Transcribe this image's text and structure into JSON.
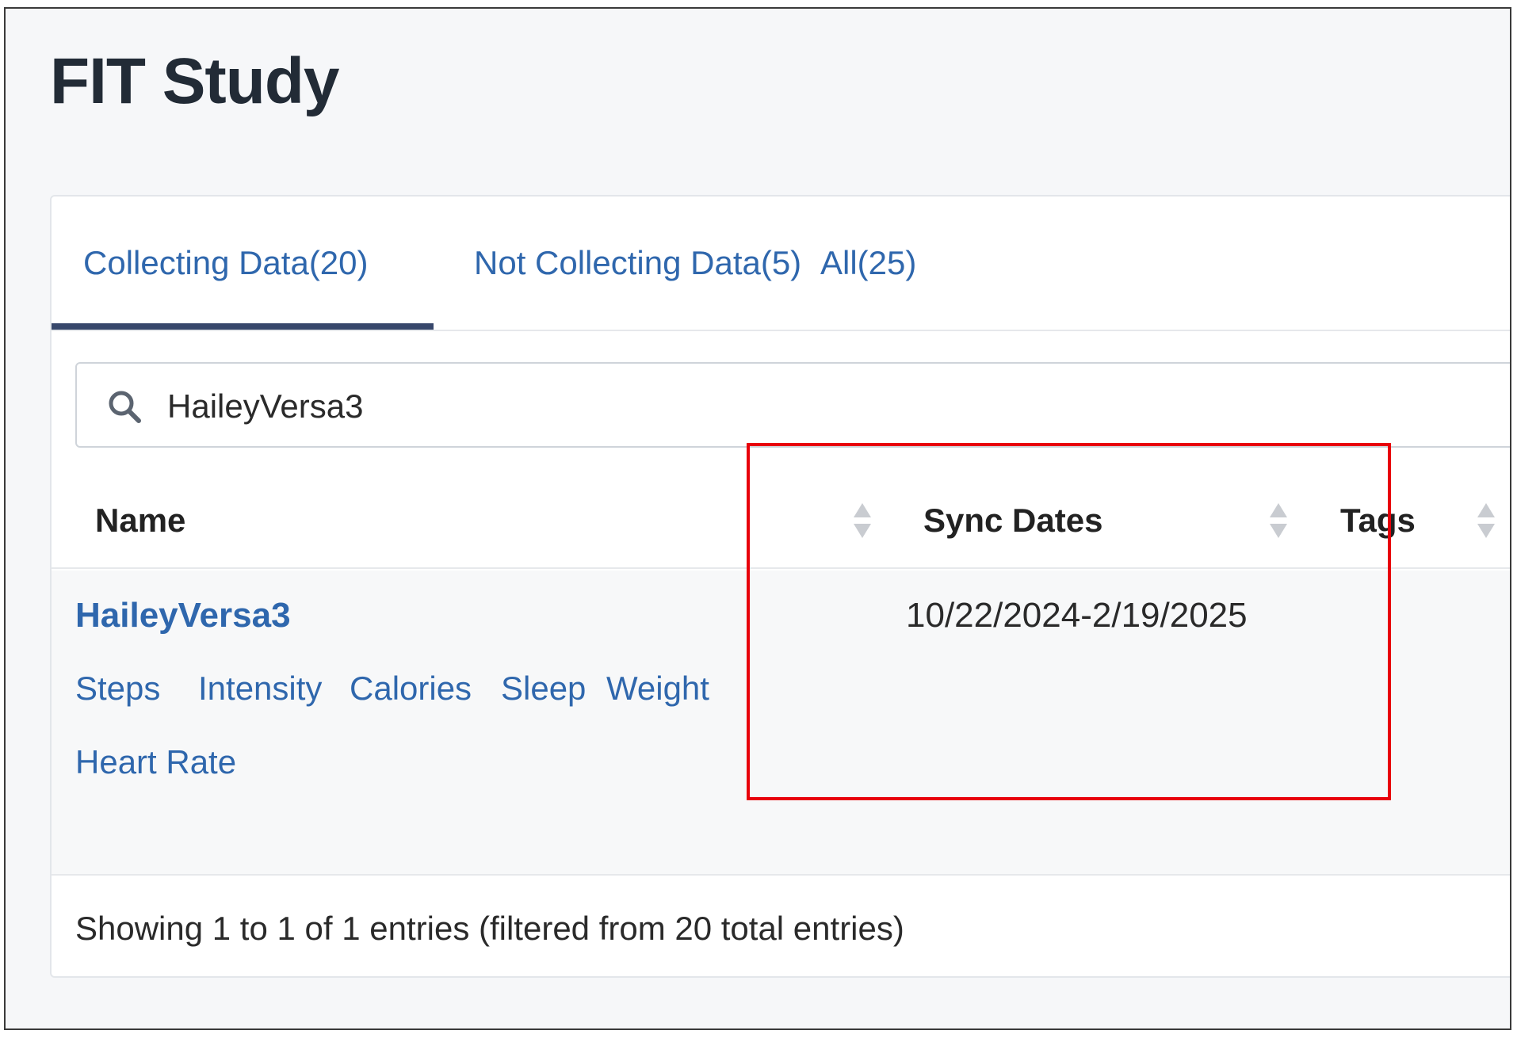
{
  "page": {
    "title": "FIT Study"
  },
  "tabs": [
    {
      "label": "Collecting Data(20)",
      "active": true
    },
    {
      "label": "Not Collecting Data(5)",
      "active": false
    },
    {
      "label": "All(25)",
      "active": false
    }
  ],
  "search": {
    "value": "HaileyVersa3",
    "icon": "search-icon"
  },
  "table": {
    "columns": [
      {
        "label": "Name",
        "sortable": true
      },
      {
        "label": "Sync Dates",
        "sortable": true
      },
      {
        "label": "Tags",
        "sortable": true
      }
    ],
    "rows": [
      {
        "name": "HaileyVersa3",
        "data_types": [
          "Steps",
          "Intensity",
          "Calories",
          "Sleep",
          "Weight",
          "Heart Rate"
        ],
        "sync_dates": "10/22/2024-2/19/2025",
        "tags": ""
      }
    ]
  },
  "footer": {
    "info": "Showing 1 to 1 of 1 entries (filtered from 20 total entries)"
  },
  "colors": {
    "link": "#2f67ad",
    "tab_indicator": "#37476b",
    "highlight": "#e8000b"
  }
}
